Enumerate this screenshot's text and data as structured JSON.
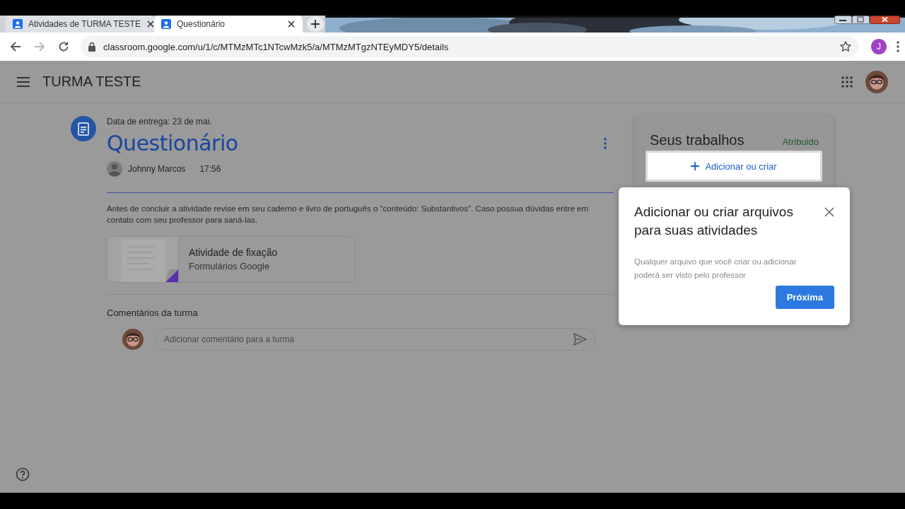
{
  "browser": {
    "tabs": [
      {
        "title": "Atividades de TURMA TESTE",
        "selected": false
      },
      {
        "title": "Questionário",
        "selected": true
      }
    ],
    "url": "classroom.google.com/u/1/c/MTMzMTc1NTcwMzk5/a/MTMzMTgzNTEyMDY5/details",
    "profile_initial": "J"
  },
  "app_bar": {
    "title": "TURMA TESTE"
  },
  "assignment": {
    "due": "Data de entrega: 23 de mai.",
    "title": "Questionário",
    "author": "Johnny Marcos",
    "time": "17:56",
    "description": "Antes de concluir a atividade revise em seu caderno e livro de português o “conteúdo: Substantivos”. Caso possua dúvidas entre em contato com seu professor para saná-las.",
    "attachment": {
      "title": "Atividade de fixação",
      "subtitle": "Formulários Google"
    }
  },
  "comments": {
    "heading": "Comentários da turma",
    "placeholder": "Adicionar comentário para a turma"
  },
  "your_work": {
    "title": "Seus trabalhos",
    "status": "Atribuido",
    "add_button": "Adicionar ou criar"
  },
  "dialog": {
    "title": "Adicionar ou criar arquivos para suas atividades",
    "body": "Qualquer arquivo que você criar ou adicionar poderá ser visto pelo professor",
    "button": "Próxima"
  }
}
